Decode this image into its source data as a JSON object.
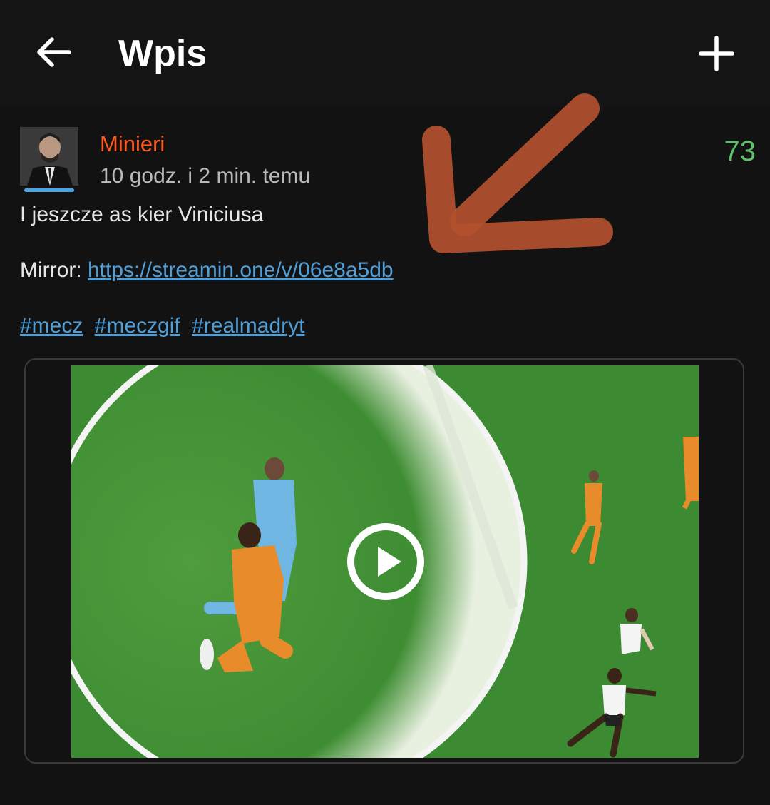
{
  "header": {
    "title": "Wpis"
  },
  "post": {
    "author": "Minieri",
    "time": "10 godz. i 2 min. temu",
    "votes": "73",
    "text": "I jeszcze as kier Viniciusa",
    "mirror_label": "Mirror: ",
    "mirror_url": "https://streamin.one/v/06e8a5db",
    "tags": [
      "#mecz",
      "#meczgif",
      "#realmadryt"
    ]
  },
  "colors": {
    "background": "#121212",
    "author": "#ff5a1f",
    "votes": "#5fbf6a",
    "link": "#4f9ed8",
    "annotation_arrow": "#b3502f"
  },
  "icons": {
    "back": "arrow-left-icon",
    "add": "plus-icon",
    "play": "play-icon"
  }
}
